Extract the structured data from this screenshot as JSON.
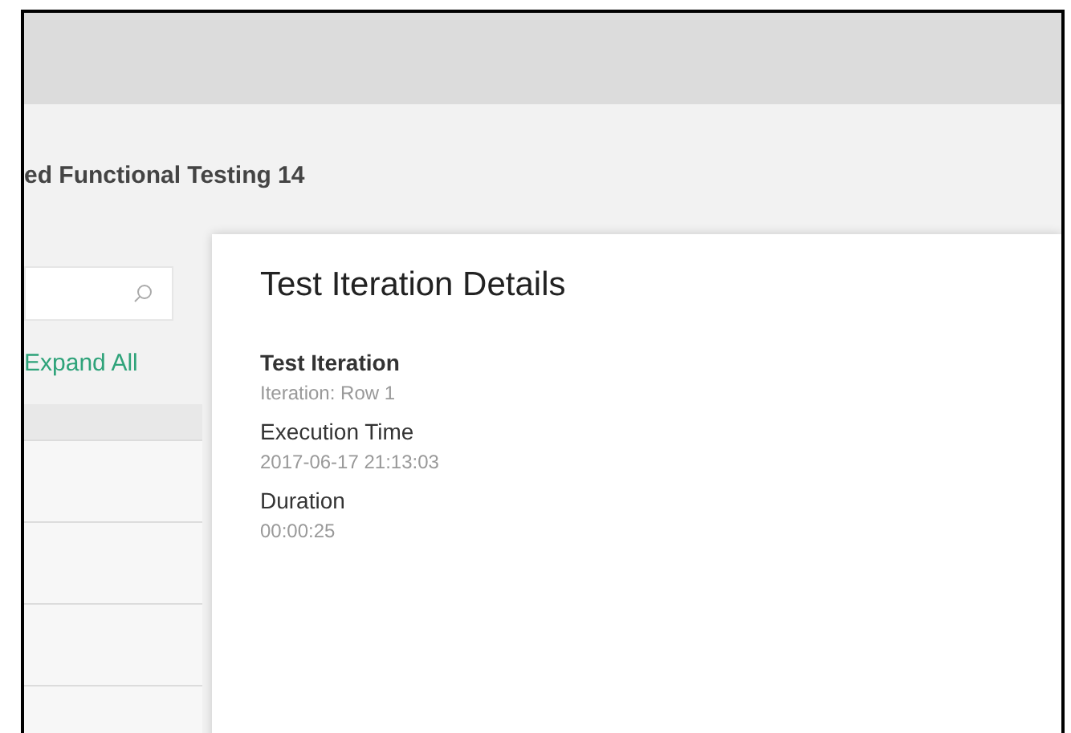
{
  "page_title": "ed Functional Testing 14",
  "sidebar": {
    "expand_link": "Expand All"
  },
  "details": {
    "title": "Test Iteration Details",
    "fields": [
      {
        "label": "Test Iteration",
        "value": "Iteration: Row 1",
        "kind": "bold"
      },
      {
        "label": "Execution Time",
        "value": "2017-06-17 21:13:03",
        "kind": "plain"
      },
      {
        "label": "Duration",
        "value": "00:00:25",
        "kind": "plain"
      }
    ]
  }
}
